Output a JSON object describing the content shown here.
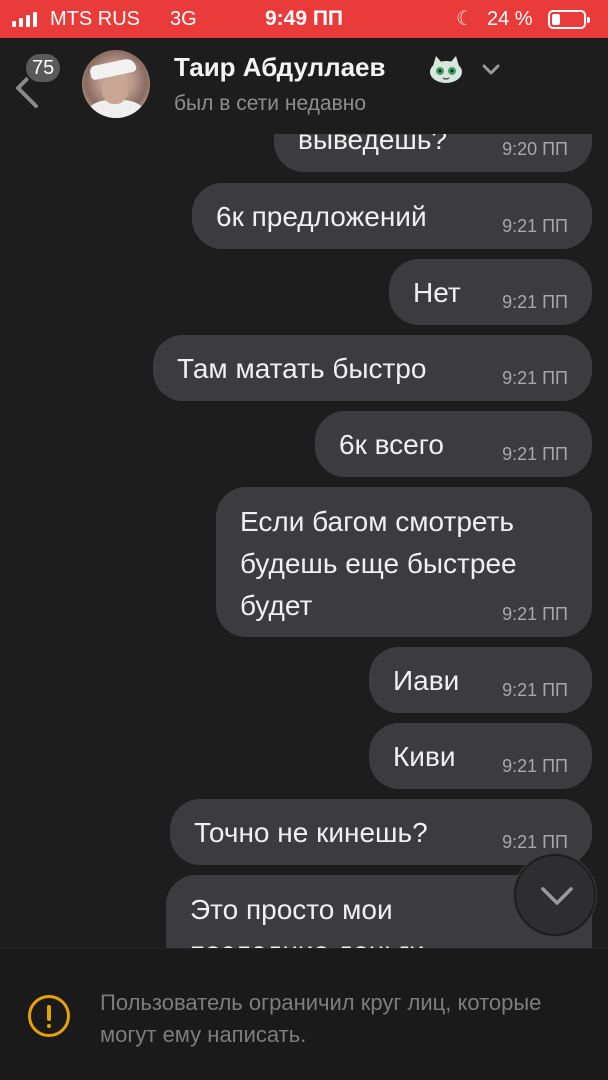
{
  "status_bar": {
    "carrier": "MTS RUS",
    "network": "3G",
    "time": "9:49 ПП",
    "battery_percent": "24 %",
    "icons": [
      "signal-icon",
      "moon-icon",
      "battery-icon"
    ]
  },
  "header": {
    "unread_count": "75",
    "contact_name": "Таир Абдуллаев",
    "contact_status": "был в сети недавно",
    "icons": [
      "back-arrow-icon",
      "cat-sticker-icon",
      "chevron-down-icon"
    ]
  },
  "messages": [
    {
      "text": "выведешь?",
      "time": "9:20 ПП"
    },
    {
      "text": "6к предложений",
      "time": "9:21 ПП"
    },
    {
      "text": "Нет",
      "time": "9:21 ПП"
    },
    {
      "text": "Там матать быстро",
      "time": "9:21 ПП"
    },
    {
      "text": "6к всего",
      "time": "9:21 ПП"
    },
    {
      "text_lines": [
        "Если багом смотреть",
        "будешь еще быстрее",
        "будет"
      ],
      "time": "9:21 ПП"
    },
    {
      "text": "Иави",
      "time": "9:21 ПП"
    },
    {
      "text": "Киви",
      "time": "9:21 ПП"
    },
    {
      "text": "Точно не кинешь?",
      "time": "9:21 ПП"
    },
    {
      "text_lines": [
        "Это просто мои",
        "последние деньги"
      ]
    }
  ],
  "footer": {
    "notice": "Пользователь ограничил круг лиц, которые могут ему написать."
  },
  "colors": {
    "status_bar": "#ea3b3b",
    "background": "#1d1d1d",
    "bubble": "#3c3c3e",
    "warning": "#e5a200"
  }
}
